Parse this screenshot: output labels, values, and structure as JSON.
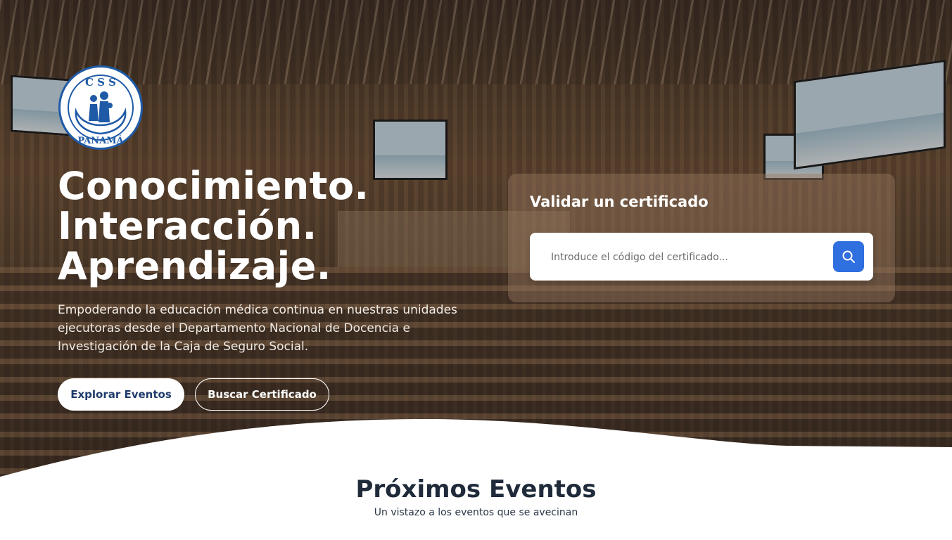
{
  "logo": {
    "top_text": "C S S",
    "bottom_text": "PANAMÁ"
  },
  "hero": {
    "headline": [
      "Conocimiento.",
      "Interacción.",
      "Aprendizaje."
    ],
    "lead": "Empoderando la educación médica continua en nuestras unidades ejecutoras desde el Departamento Nacional de Docencia e Investigación de la Caja de Seguro Social.",
    "primary_button": "Explorar Eventos",
    "secondary_button": "Buscar Certificado"
  },
  "validate": {
    "title": "Validar un certificado",
    "placeholder": "Introduce el código del certificado...",
    "search_icon": "search-icon"
  },
  "events": {
    "title": "Próximos Eventos",
    "subtitle": "Un vistazo a los eventos que se avecinan"
  },
  "colors": {
    "accent": "#2f6fe0",
    "heading_dark": "#1f2a3a",
    "primary_button_text": "#1f3b6b",
    "logo_blue": "#1f5aa6"
  }
}
